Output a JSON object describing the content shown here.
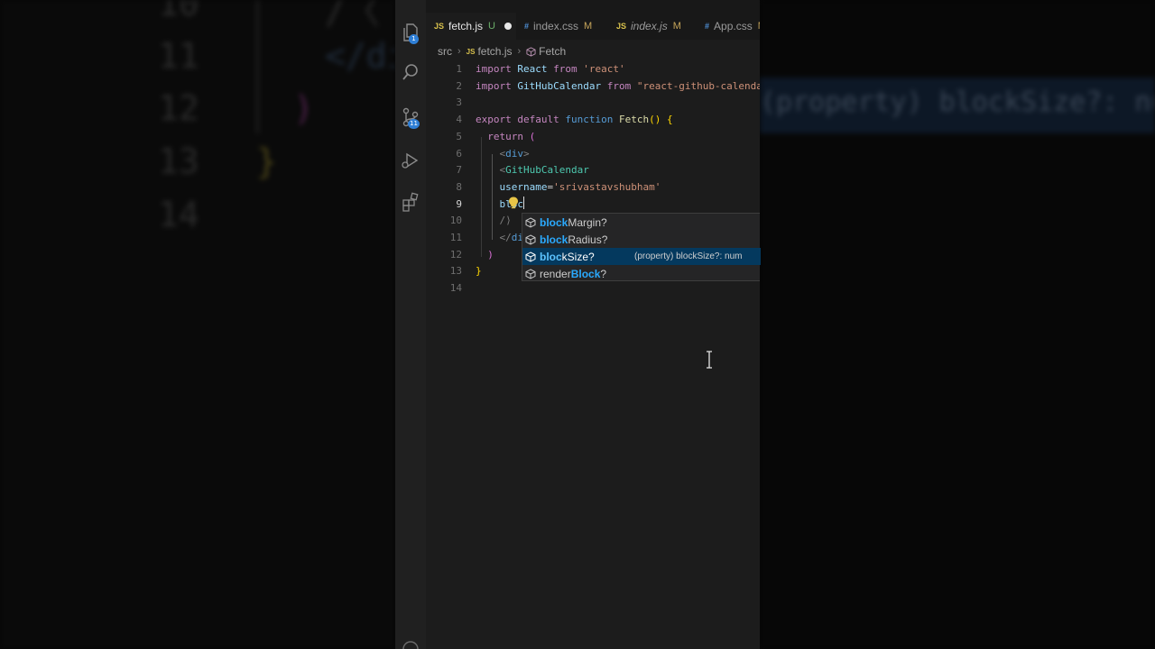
{
  "tabs": [
    {
      "icon": "JS",
      "name": "fetch.js",
      "status": "U",
      "unsaved": true,
      "active": true
    },
    {
      "icon": "#",
      "name": "index.css",
      "status": "M"
    },
    {
      "icon": "JS",
      "name": "index.js",
      "status": "M"
    },
    {
      "icon": "#",
      "name": "App.css",
      "status": "M"
    }
  ],
  "breadcrumb": [
    "src",
    "fetch.js",
    "Fetch"
  ],
  "activity_bar": {
    "explorer_badge": "1",
    "scm_badge": "11"
  },
  "editor": {
    "lines": [
      {
        "n": "1",
        "tokens": [
          [
            "kw",
            "import"
          ],
          [
            "p",
            " "
          ],
          [
            "id",
            "React"
          ],
          [
            "p",
            " "
          ],
          [
            "kw",
            "from"
          ],
          [
            "p",
            " "
          ],
          [
            "str",
            "'react'"
          ]
        ]
      },
      {
        "n": "2",
        "tokens": [
          [
            "kw",
            "import"
          ],
          [
            "p",
            " "
          ],
          [
            "id",
            "GitHubCalendar"
          ],
          [
            "p",
            " "
          ],
          [
            "kw",
            "from"
          ],
          [
            "p",
            " "
          ],
          [
            "str",
            "\"react-github-calendar\""
          ]
        ]
      },
      {
        "n": "3",
        "tokens": []
      },
      {
        "n": "4",
        "tokens": [
          [
            "kw",
            "export"
          ],
          [
            "p",
            " "
          ],
          [
            "kw",
            "default"
          ],
          [
            "p",
            " "
          ],
          [
            "kb",
            "function"
          ],
          [
            "p",
            " "
          ],
          [
            "fn",
            "Fetch"
          ],
          [
            "br1",
            "()"
          ],
          [
            "p",
            " "
          ],
          [
            "br1",
            "{"
          ]
        ]
      },
      {
        "n": "5",
        "tokens": [
          [
            "p",
            "  "
          ],
          [
            "kw",
            "return"
          ],
          [
            "p",
            " "
          ],
          [
            "br2",
            "("
          ]
        ]
      },
      {
        "n": "6",
        "tokens": [
          [
            "p",
            "    "
          ],
          [
            "tg",
            "<"
          ],
          [
            "kb",
            "div"
          ],
          [
            "tg",
            ">"
          ]
        ]
      },
      {
        "n": "7",
        "tokens": [
          [
            "p",
            "    "
          ],
          [
            "tg",
            "<"
          ],
          [
            "comp",
            "GitHubCalendar"
          ]
        ]
      },
      {
        "n": "8",
        "tokens": [
          [
            "p",
            "    "
          ],
          [
            "id",
            "username"
          ],
          [
            "p",
            "="
          ],
          [
            "str",
            "'srivastavshubham'"
          ]
        ]
      },
      {
        "n": "9",
        "tokens": [
          [
            "p",
            "    "
          ],
          [
            "id",
            "bloc"
          ]
        ],
        "caret": true
      },
      {
        "n": "10",
        "tokens": [
          [
            "p",
            "    "
          ],
          [
            "tg",
            "/"
          ],
          [
            "tg",
            "⟩"
          ]
        ]
      },
      {
        "n": "11",
        "tokens": [
          [
            "p",
            "    "
          ],
          [
            "tg",
            "</"
          ],
          [
            "kb",
            "di"
          ]
        ]
      },
      {
        "n": "12",
        "tokens": [
          [
            "p",
            "  "
          ],
          [
            "br2",
            ")"
          ]
        ]
      },
      {
        "n": "13",
        "tokens": [
          [
            "br1",
            "}"
          ]
        ]
      },
      {
        "n": "14",
        "tokens": []
      }
    ]
  },
  "suggestions": [
    {
      "match": "block",
      "rest": "Margin?"
    },
    {
      "match": "block",
      "rest": "Radius?"
    },
    {
      "match": "bloc",
      "rest": "kSize?",
      "selected": true,
      "detail": "(property) blockSize?: num"
    },
    {
      "match": "",
      "pre": "render",
      "mid": "Block",
      "rest": "?"
    }
  ],
  "background": {
    "left_lines": [
      "10",
      "11",
      "12",
      "13",
      "14"
    ],
    "left_code": [
      "/〈",
      "</di",
      ")",
      "}"
    ],
    "right_detail": "(property) blockSize?: num"
  },
  "colors": {
    "accent": "#04395e",
    "editor_bg": "#1c1c1c",
    "activity_bar": "#202020"
  }
}
